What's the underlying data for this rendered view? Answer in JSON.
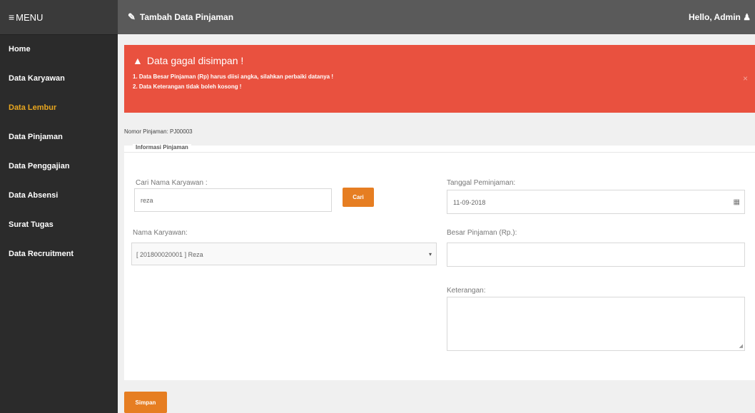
{
  "sidebar": {
    "menu_label": "MENU",
    "items": [
      {
        "label": "Home"
      },
      {
        "label": "Data Karyawan"
      },
      {
        "label": "Data Lembur"
      },
      {
        "label": "Data Pinjaman"
      },
      {
        "label": "Data Penggajian"
      },
      {
        "label": "Data Absensi"
      },
      {
        "label": "Surat Tugas"
      },
      {
        "label": "Data Recruitment"
      }
    ],
    "active_index": 2
  },
  "topbar": {
    "title": "Tambah Data Pinjaman",
    "greeting": "Hello, Admin"
  },
  "alert": {
    "title": "Data gagal disimpan !",
    "messages": [
      "1. Data Besar Pinjaman (Rp) harus diisi angka, silahkan perbaiki datanya !",
      "2. Data Keterangan tidak boleh kosong !"
    ],
    "close": "×"
  },
  "nomor_pinjaman": "Nomor Pinjaman: PJ00003",
  "form": {
    "legend": "Informasi Pinjaman",
    "cari_label": "Cari Nama Karyawan :",
    "cari_value": "reza",
    "cari_button": "Cari",
    "nama_label": "Nama Karyawan:",
    "nama_value": "[ 201800020001 ] Reza",
    "tanggal_label": "Tanggal Peminjaman:",
    "tanggal_value": "11-09-2018",
    "besar_label": "Besar Pinjaman (Rp.):",
    "besar_value": "",
    "keterangan_label": "Keterangan:",
    "keterangan_value": ""
  },
  "simpan_button": "Simpan",
  "colors": {
    "sidebar_bg": "#2b2b2b",
    "topbar_bg": "#5a5a5a",
    "alert_bg": "#e9513f",
    "accent": "#e67e22",
    "active_menu": "#e8a61f"
  }
}
